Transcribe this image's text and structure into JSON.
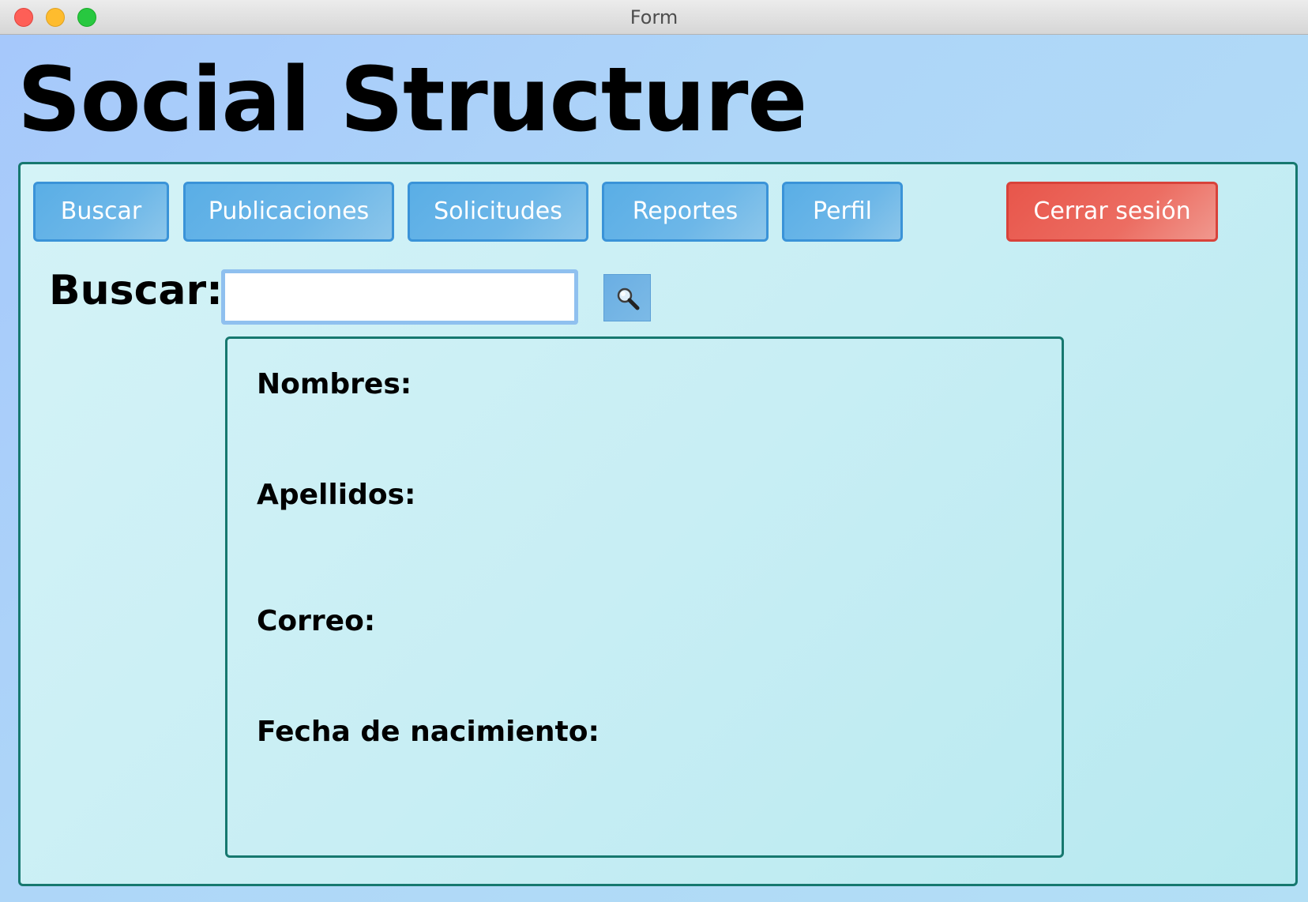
{
  "window": {
    "title": "Form"
  },
  "app": {
    "title": "Social Structure"
  },
  "nav": {
    "buscar_label": "Buscar",
    "publicaciones_label": "Publicaciones",
    "solicitudes_label": "Solicitudes",
    "reportes_label": "Reportes",
    "perfil_label": "Perfil",
    "logout_label": "Cerrar sesión"
  },
  "search": {
    "label": "Buscar:",
    "value": "",
    "icon": "magnifier-icon"
  },
  "profile": {
    "nombres_label": "Nombres:",
    "apellidos_label": "Apellidos:",
    "correo_label": "Correo:",
    "fecha_label": "Fecha de nacimiento:"
  },
  "colors": {
    "nav_button": "#5aaee6",
    "logout_button": "#e8564b",
    "panel_border": "#16786f",
    "background": "#a6c8fb"
  }
}
